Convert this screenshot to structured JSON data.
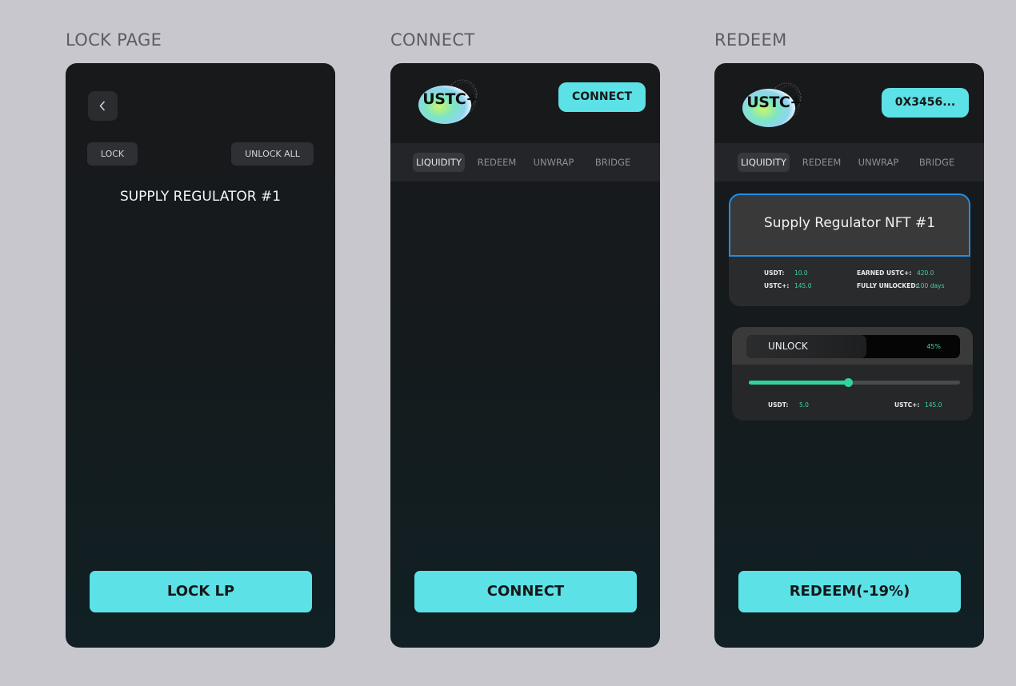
{
  "colors": {
    "accent": "#5ce1e6",
    "positive": "#3fd3a2",
    "highlight_border": "#1f8fe6"
  },
  "sections": {
    "lock": {
      "heading": "LOCK PAGE",
      "back_icon": "chevron-left-icon",
      "lock_label": "LOCK",
      "unlock_all_label": "UNLOCK ALL",
      "title": "SUPPLY REGULATOR #1",
      "cta_label": "LOCK LP"
    },
    "connect": {
      "heading": "CONNECT",
      "logo_text": "USTC+",
      "header_button": "CONNECT",
      "tabs": [
        {
          "label": "LIQUIDITY",
          "active": true
        },
        {
          "label": "REDEEM"
        },
        {
          "label": "UNWRAP"
        },
        {
          "label": "BRIDGE"
        }
      ],
      "cta_label": "CONNECT"
    },
    "redeem": {
      "heading": "REDEEM",
      "logo_text": "USTC+",
      "wallet_address": "0X3456...",
      "tabs": [
        {
          "label": "LIQUIDITY",
          "active": true
        },
        {
          "label": "REDEEM"
        },
        {
          "label": "UNWRAP"
        },
        {
          "label": "BRIDGE"
        }
      ],
      "nft": {
        "title": "Supply Regulator NFT #1",
        "usdt_label": "USDT:",
        "usdt_value": "10.0",
        "ustc_label": "USTC+:",
        "ustc_value": "145.0",
        "earned_label": "EARNED USTC+:",
        "earned_value": "420.0",
        "unlocked_label": "FULLY UNLOCKED:",
        "unlocked_value": "100 days"
      },
      "unlock": {
        "label": "UNLOCK",
        "percent_text": "45%",
        "progress": 0.56,
        "slider_level": 0.47,
        "usdt_label": "USDT:",
        "usdt_value": "5.0",
        "ustc_label": "USTC+:",
        "ustc_value": "145.0"
      },
      "cta_label": "REDEEM(-19%)"
    }
  }
}
